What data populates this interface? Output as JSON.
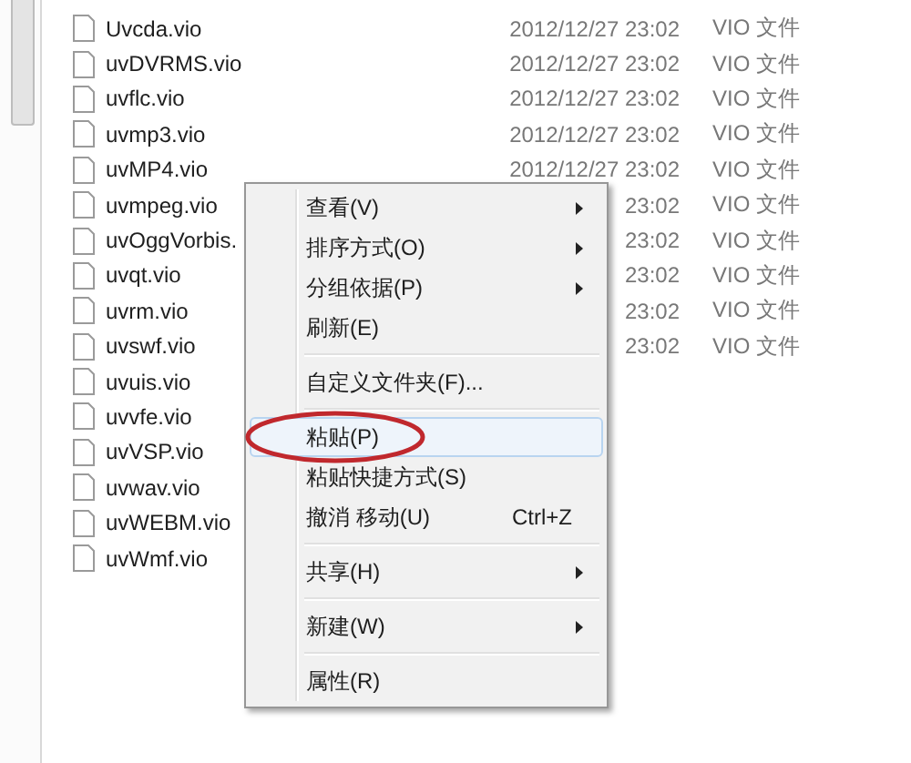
{
  "files": [
    {
      "name": "Uvcda.vio",
      "date": "2012/12/27 23:02",
      "type": "VIO 文件"
    },
    {
      "name": "uvDVRMS.vio",
      "date": "2012/12/27 23:02",
      "type": "VIO 文件"
    },
    {
      "name": "uvflc.vio",
      "date": "2012/12/27 23:02",
      "type": "VIO 文件"
    },
    {
      "name": "uvmp3.vio",
      "date": "2012/12/27 23:02",
      "type": "VIO 文件"
    },
    {
      "name": "uvMP4.vio",
      "date": "2012/12/27 23:02",
      "type": "VIO 文件"
    },
    {
      "name": "uvmpeg.vio",
      "date": "23:02",
      "type": "VIO 文件"
    },
    {
      "name": "uvOggVorbis.",
      "date": "23:02",
      "type": "VIO 文件"
    },
    {
      "name": "uvqt.vio",
      "date": "23:02",
      "type": "VIO 文件"
    },
    {
      "name": "uvrm.vio",
      "date": "23:02",
      "type": "VIO 文件"
    },
    {
      "name": "uvswf.vio",
      "date": "23:02",
      "type": "VIO 文件"
    },
    {
      "name": "uvuis.vio"
    },
    {
      "name": "uvvfe.vio"
    },
    {
      "name": "uvVSP.vio"
    },
    {
      "name": "uvwav.vio"
    },
    {
      "name": "uvWEBM.vio"
    },
    {
      "name": "uvWmf.vio"
    }
  ],
  "context_menu": [
    {
      "kind": "item",
      "label": "查看(V)",
      "submenu": true,
      "selected": false
    },
    {
      "kind": "item",
      "label": "排序方式(O)",
      "submenu": true,
      "selected": false
    },
    {
      "kind": "item",
      "label": "分组依据(P)",
      "submenu": true,
      "selected": false
    },
    {
      "kind": "item",
      "label": "刷新(E)",
      "submenu": false,
      "selected": false
    },
    {
      "kind": "separator"
    },
    {
      "kind": "item",
      "label": "自定义文件夹(F)...",
      "submenu": false,
      "selected": false
    },
    {
      "kind": "separator"
    },
    {
      "kind": "item",
      "label": "粘贴(P)",
      "submenu": false,
      "selected": true,
      "circled": true
    },
    {
      "kind": "item",
      "label": "粘贴快捷方式(S)",
      "submenu": false,
      "selected": false
    },
    {
      "kind": "item",
      "label": "撤消 移动(U)",
      "shortcut": "Ctrl+Z",
      "submenu": false,
      "selected": false
    },
    {
      "kind": "separator"
    },
    {
      "kind": "item",
      "label": "共享(H)",
      "submenu": true,
      "selected": false
    },
    {
      "kind": "separator"
    },
    {
      "kind": "item",
      "label": "新建(W)",
      "submenu": true,
      "selected": false
    },
    {
      "kind": "separator"
    },
    {
      "kind": "item",
      "label": "属性(R)",
      "submenu": false,
      "selected": false
    }
  ]
}
